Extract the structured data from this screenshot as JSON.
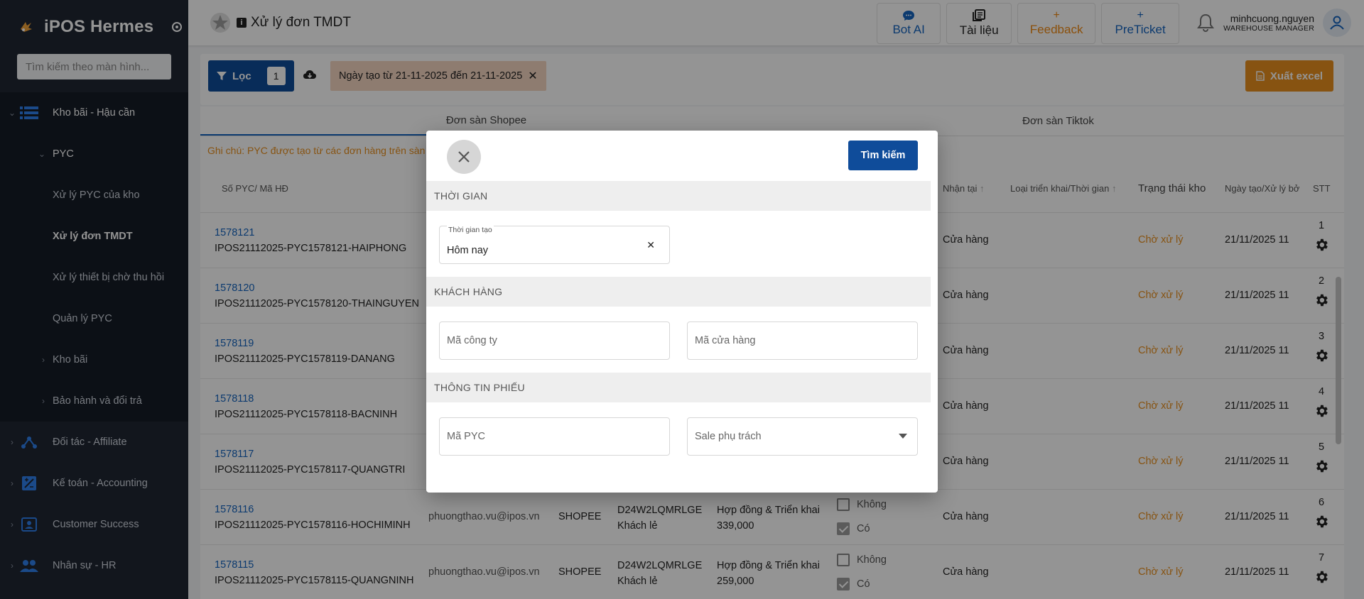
{
  "app": {
    "name": "iPOS Hermes"
  },
  "sidebar": {
    "search_placeholder": "Tìm kiếm theo màn hình...",
    "section": "Kho bãi - Hậu cần",
    "pyc": "PYC",
    "pyc_items": [
      "Xử lý PYC của kho",
      "Xử lý đơn TMDT",
      "Xử lý thiết bị chờ thu hồi",
      "Quản lý PYC"
    ],
    "sub_groups": [
      "Kho bãi",
      "Bảo hành và đổi trả"
    ],
    "groups": [
      "Đối tác - Affiliate",
      "Kế toán - Accounting",
      "Customer Success",
      "Nhân sự - HR"
    ]
  },
  "header": {
    "title": "Xử lý đơn TMDT",
    "buttons": {
      "bot": "Bot AI",
      "docs": "Tài liệu",
      "feedback": "Feedback",
      "preticket": "PreTicket"
    },
    "user_name": "minhcuong.nguyen",
    "user_role": "WAREHOUSE MANAGER"
  },
  "filter": {
    "filter_label": "Lọc",
    "filter_count": "1",
    "chip": "Ngày tạo từ 21-11-2025 đến 21-11-2025",
    "export_label": "Xuất excel"
  },
  "tabs": [
    "Đơn sàn Shopee",
    "Đơn sàn Tiktok"
  ],
  "note": "Ghi chú: PYC được tạo từ các đơn hàng trên sàn",
  "table": {
    "headers": {
      "code": "Số PYC/ Mã HĐ",
      "recv": "Nhận tại",
      "deploy": "Loại triển khai/Thời gian",
      "status": "Trạng thái kho",
      "date": "Ngày tạo/Xử lý bở",
      "stt": "STT"
    },
    "rows": [
      {
        "num": "1578121",
        "code": "IPOS21112025-PYC1578121-HAIPHONG",
        "email": "",
        "src": "",
        "shop": "",
        "shop2": "",
        "pkg": "",
        "pkg2": "",
        "recv": "Cửa hàng",
        "status": "Chờ xử lý",
        "date": "21/11/2025 11",
        "stt": "1"
      },
      {
        "num": "1578120",
        "code": "IPOS21112025-PYC1578120-THAINGUYEN",
        "email": "",
        "src": "",
        "shop": "",
        "shop2": "",
        "pkg": "",
        "pkg2": "",
        "recv": "Cửa hàng",
        "status": "Chờ xử lý",
        "date": "21/11/2025 11",
        "stt": "2"
      },
      {
        "num": "1578119",
        "code": "IPOS21112025-PYC1578119-DANANG",
        "email": "",
        "src": "",
        "shop": "",
        "shop2": "",
        "pkg": "",
        "pkg2": "",
        "recv": "Cửa hàng",
        "status": "Chờ xử lý",
        "date": "21/11/2025 11",
        "stt": "3"
      },
      {
        "num": "1578118",
        "code": "IPOS21112025-PYC1578118-BACNINH",
        "email": "",
        "src": "",
        "shop": "",
        "shop2": "",
        "pkg": "",
        "pkg2": "",
        "recv": "Cửa hàng",
        "status": "Chờ xử lý",
        "date": "21/11/2025 11",
        "stt": "4"
      },
      {
        "num": "1578117",
        "code": "IPOS21112025-PYC1578117-QUANGTRI",
        "email": "",
        "src": "",
        "shop": "",
        "shop2": "",
        "pkg": "",
        "pkg2": "",
        "recv": "Cửa hàng",
        "status": "Chờ xử lý",
        "date": "21/11/2025 11",
        "stt": "5"
      },
      {
        "num": "1578116",
        "code": "IPOS21112025-PYC1578116-HOCHIMINH",
        "email": "phuongthao.vu@ipos.vn",
        "src": "SHOPEE",
        "shop": "D24W2LQMRLGE",
        "shop2": "Khách lẻ",
        "pkg": "Hợp đồng & Triển khai",
        "pkg2": "339,000",
        "recv": "Cửa hàng",
        "status": "Chờ xử lý",
        "date": "21/11/2025 11",
        "stt": "6"
      },
      {
        "num": "1578115",
        "code": "IPOS21112025-PYC1578115-QUANGNINH",
        "email": "phuongthao.vu@ipos.vn",
        "src": "SHOPEE",
        "shop": "D24W2LQMRLGE",
        "shop2": "Khách lẻ",
        "pkg": "Hợp đồng & Triển khai",
        "pkg2": "259,000",
        "recv": "Cửa hàng",
        "status": "Chờ xử lý",
        "date": "21/11/2025 11",
        "stt": "7"
      }
    ],
    "flag_no": "Không",
    "flag_yes": "Có"
  },
  "modal": {
    "search_label": "Tìm kiếm",
    "sections": {
      "time": "THỜI GIAN",
      "customer": "KHÁCH HÀNG",
      "ticket": "THÔNG TIN PHIẾU"
    },
    "created_time_label": "Thời gian tạo",
    "created_time_value": "Hôm nay",
    "company_placeholder": "Mã công ty",
    "store_placeholder": "Mã cửa hàng",
    "pyc_placeholder": "Mã PYC",
    "sale_placeholder": "Sale phụ trách"
  },
  "colors": {
    "primary": "#0f4c9a",
    "accent": "#e8901e",
    "sidebar": "#1f2733"
  }
}
